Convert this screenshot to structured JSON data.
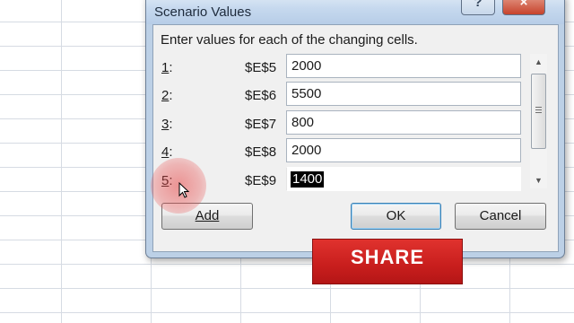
{
  "dialog": {
    "title": "Scenario Values",
    "help_label": "?",
    "close_label": "×",
    "instruction": "Enter values for each of the changing cells.",
    "rows": [
      {
        "num": "1",
        "cell": "$E$5",
        "value": "2000"
      },
      {
        "num": "2",
        "cell": "$E$6",
        "value": "5500"
      },
      {
        "num": "3",
        "cell": "$E$7",
        "value": "800"
      },
      {
        "num": "4",
        "cell": "$E$8",
        "value": "2000"
      },
      {
        "num": "5",
        "cell": "$E$9",
        "value": "1400"
      }
    ],
    "buttons": {
      "add": "Add",
      "ok": "OK",
      "cancel": "Cancel"
    }
  },
  "overlay": {
    "share_label": "SHARE"
  },
  "icons": {
    "help": "help-icon",
    "close": "close-icon",
    "cursor": "mouse-pointer-icon"
  },
  "colors": {
    "share_red": "#d42826",
    "click_highlight": "#e84646",
    "selection": "#000000"
  }
}
